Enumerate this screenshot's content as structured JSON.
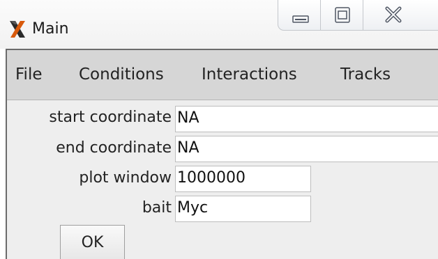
{
  "window": {
    "title": "Main",
    "app_icon": "x-logo-icon",
    "controls": [
      "minimize-icon",
      "maximize-icon",
      "close-icon"
    ]
  },
  "menubar": {
    "items": [
      "File",
      "Conditions",
      "Interactions",
      "Tracks"
    ]
  },
  "form": {
    "start_coordinate": {
      "label": "start coordinate",
      "value": "NA"
    },
    "end_coordinate": {
      "label": "end coordinate",
      "value": "NA"
    },
    "plot_window": {
      "label": "plot window",
      "value": "1000000"
    },
    "bait": {
      "label": "bait",
      "value": "Myc"
    },
    "ok_label": "OK"
  }
}
